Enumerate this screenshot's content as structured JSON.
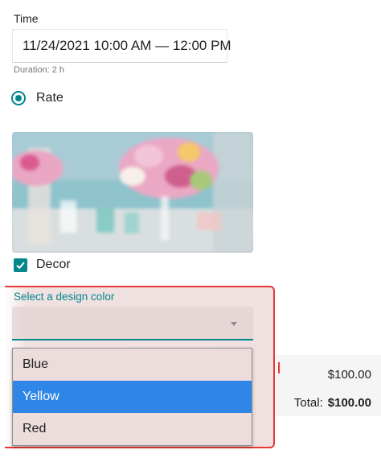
{
  "time": {
    "label": "Time",
    "value": "11/24/2021 10:00 AM — 12:00 PM",
    "duration": "Duration: 2 h"
  },
  "rate": {
    "label": "Rate",
    "selected": true
  },
  "decor": {
    "label": "Decor",
    "checked": true,
    "image_icon": "decor-photo"
  },
  "design_color": {
    "label": "Select a design color",
    "value": "",
    "options": [
      "Blue",
      "Yellow",
      "Red"
    ],
    "highlighted": "Yellow"
  },
  "summary": {
    "amount": "$100.00",
    "total_label": "Total:",
    "total_value": "$100.00"
  },
  "colors": {
    "accent": "#00868b",
    "option_highlight": "#2f86e6",
    "annotation": "#e53935"
  }
}
